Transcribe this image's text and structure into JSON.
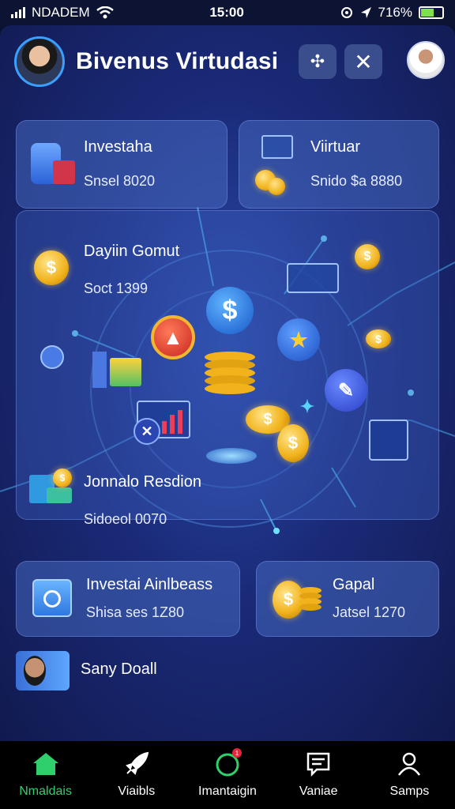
{
  "status_bar": {
    "carrier": "NDADEM",
    "time": "15:00",
    "battery": "716%",
    "battery_level": 0.62,
    "icons": [
      "signal-icon",
      "wifi-icon",
      "alarm-icon",
      "location-icon",
      "battery-icon"
    ]
  },
  "header": {
    "title": "Bivenus Virtudasi",
    "grid_button_icon": "apps-icon",
    "close_button_icon": "close-icon"
  },
  "cards": {
    "top_left": {
      "title": "Investaha",
      "subtitle": "Snsel 8020"
    },
    "top_right": {
      "title": "Viirtuar",
      "subtitle": "Snido $a 8880"
    },
    "hero_top": {
      "title": "Dayiin Gomut",
      "subtitle": "Soct 1399"
    },
    "hero_bottom": {
      "title": "Jonnalo Resdion",
      "subtitle": "Sidoeol 0070"
    },
    "bottom_left": {
      "title": "Investai Ainlbeass",
      "subtitle": "Shisa ses 1Z80"
    },
    "bottom_right": {
      "title": "Gapal",
      "subtitle": "Jatsel 1270"
    }
  },
  "profile_row": {
    "name": "Sany Doall"
  },
  "colors": {
    "accent_green": "#2fd06b",
    "card_bg": "#4668be",
    "coin_gold": "#f1b21b",
    "background": "#111a4f"
  },
  "nav": [
    {
      "label": "Nmaldais",
      "icon": "home-icon",
      "active": true
    },
    {
      "label": "Viaibls",
      "icon": "rocket-icon",
      "active": false
    },
    {
      "label": "Imantaigin",
      "icon": "circle-icon",
      "active": false,
      "badge": "1"
    },
    {
      "label": "Vaniae",
      "icon": "message-icon",
      "active": false
    },
    {
      "label": "Samps",
      "icon": "user-icon",
      "active": false
    }
  ]
}
